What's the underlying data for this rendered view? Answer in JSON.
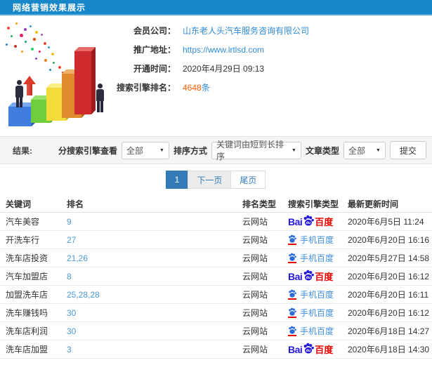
{
  "header": {
    "title": "网络营销效果展示"
  },
  "info": {
    "member_label": "会员公司：",
    "member_value": "山东老人头汽车服务咨询有限公司",
    "url_label": "推广地址：",
    "url_value": "https://www.lrtlsd.com",
    "open_label": "开通时间：",
    "open_value": "2020年4月29日 09:13",
    "rank_label": "搜索引擎排名：",
    "rank_count": "4648",
    "rank_unit": "条"
  },
  "filters": {
    "results_label": "结果:",
    "engine_filter_label": "分搜索引擎查看",
    "engine_filter_value": "全部",
    "sort_label": "排序方式",
    "sort_value": "关键词由短到长排序",
    "article_type_label": "文章类型",
    "article_type_value": "全部",
    "submit_label": "提交"
  },
  "pagination": {
    "current": "1",
    "next": "下一页",
    "last": "尾页"
  },
  "table": {
    "headers": [
      "关键词",
      "排名",
      "排名类型",
      "搜索引擎类型",
      "最新更新时间"
    ],
    "engine_logos": {
      "pc_prefix": "Bai",
      "pc_du": "du",
      "pc_cn": "百度",
      "mobile": "手机百度"
    },
    "rows": [
      {
        "keyword": "汽车美容",
        "rank": "9",
        "rank_type": "云网站",
        "engine": "pc",
        "updated": "2020年6月5日 11:24"
      },
      {
        "keyword": "开洗车行",
        "rank": "27",
        "rank_type": "云网站",
        "engine": "mobile",
        "updated": "2020年6月20日 16:16"
      },
      {
        "keyword": "洗车店投资",
        "rank": "21,26",
        "rank_type": "云网站",
        "engine": "mobile",
        "updated": "2020年5月27日 14:58"
      },
      {
        "keyword": "汽车加盟店",
        "rank": "8",
        "rank_type": "云网站",
        "engine": "pc",
        "updated": "2020年6月20日 16:12"
      },
      {
        "keyword": "加盟洗车店",
        "rank": "25,28,28",
        "rank_type": "云网站",
        "engine": "mobile",
        "updated": "2020年6月20日 16:11"
      },
      {
        "keyword": "洗车赚钱吗",
        "rank": "30",
        "rank_type": "云网站",
        "engine": "mobile",
        "updated": "2020年6月20日 16:12"
      },
      {
        "keyword": "洗车店利润",
        "rank": "30",
        "rank_type": "云网站",
        "engine": "mobile",
        "updated": "2020年6月18日 14:27"
      },
      {
        "keyword": "洗车店加盟",
        "rank": "3",
        "rank_type": "云网站",
        "engine": "pc",
        "updated": "2020年6月18日 14:30"
      }
    ]
  },
  "colors": {
    "header_bg": "#1787c9",
    "pagination_active": "#337ab7",
    "link_blue": "#2f8bd6",
    "rank_blue": "#4a9ad5",
    "highlight_orange": "#ff5a00",
    "baidu_blue": "#2319dc",
    "baidu_red": "#e10602"
  }
}
